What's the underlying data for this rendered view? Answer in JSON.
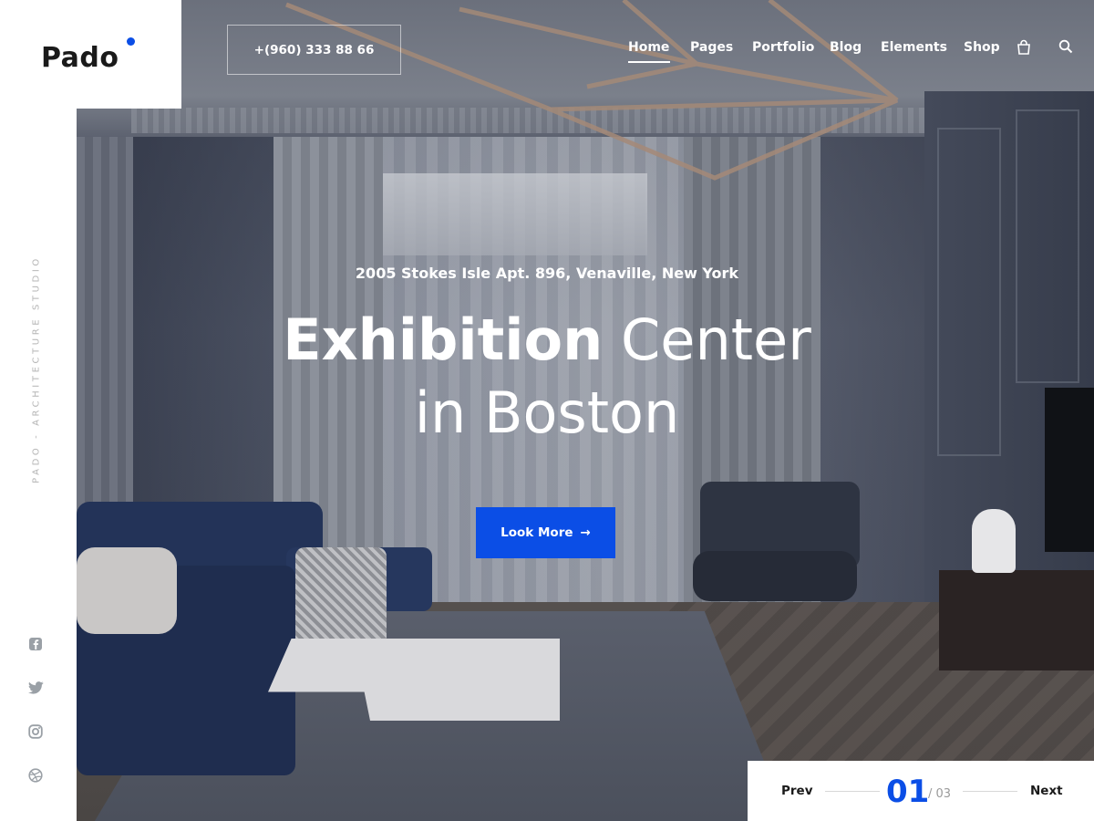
{
  "brand": {
    "name": "Pado",
    "accent_color": "#0b4ee6"
  },
  "header": {
    "phone": "+(960) 333 88 66",
    "nav": [
      "Home",
      "Pages",
      "Portfolio",
      "Blog",
      "Elements",
      "Shop"
    ],
    "active_nav": "Home",
    "icons": [
      "shopping-bag-icon",
      "search-icon"
    ]
  },
  "sidebar": {
    "vertical_text": "PADO - ARCHITECTURE STUDIO",
    "social": [
      "facebook-icon",
      "twitter-icon",
      "instagram-icon",
      "dribbble-icon"
    ]
  },
  "hero": {
    "address": "2005 Stokes Isle Apt. 896, Venaville, New York",
    "title_strong": "Exhibition",
    "title_light_1": "Center",
    "title_line2": "in Boston",
    "cta_label": "Look More",
    "cta_arrow": "→"
  },
  "pager": {
    "prev": "Prev",
    "current": "01",
    "total": "/ 03",
    "next": "Next"
  }
}
